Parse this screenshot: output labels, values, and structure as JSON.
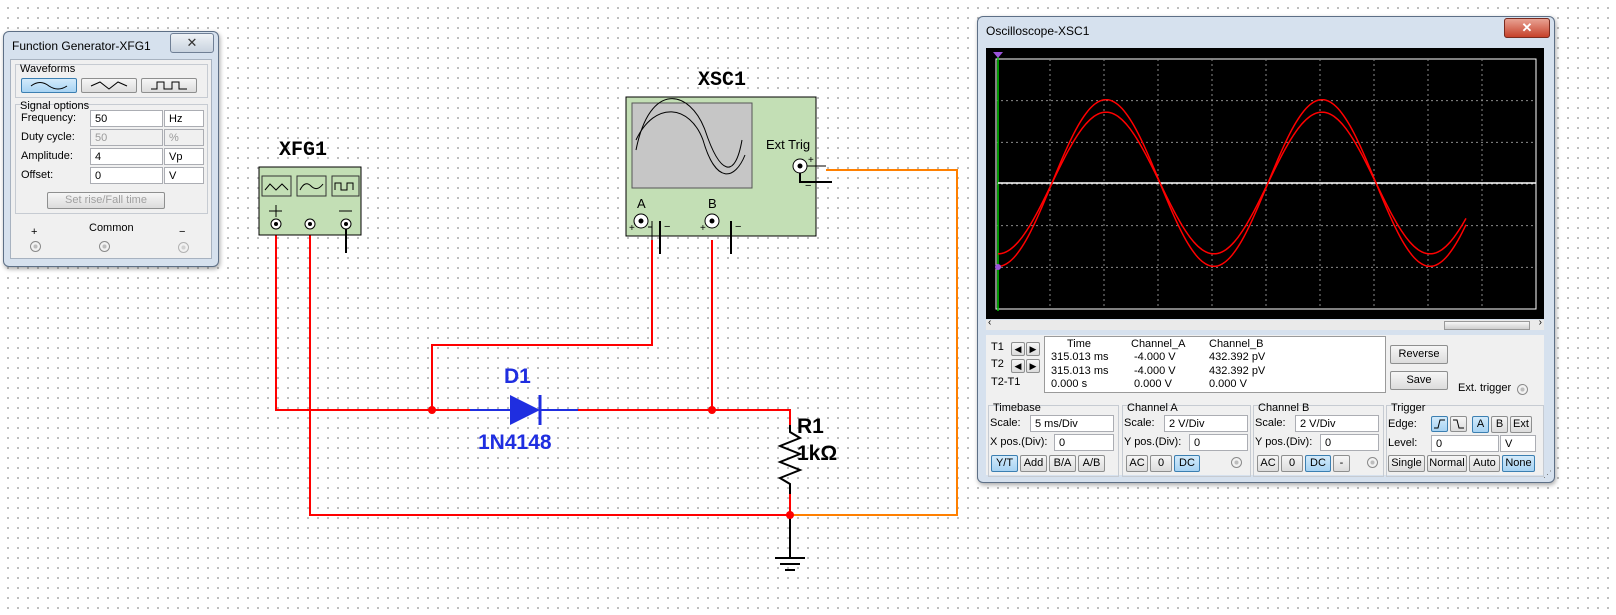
{
  "function_generator": {
    "title": "Function Generator-XFG1",
    "waveforms_label": "Waveforms",
    "waveforms": [
      "sine-wave-icon",
      "triangle-wave-icon",
      "square-wave-icon"
    ],
    "selected_waveform": "sine-wave-icon",
    "signal_options_label": "Signal options",
    "fields": [
      {
        "label": "Frequency:",
        "value": "50",
        "unit": "Hz",
        "disabled": false
      },
      {
        "label": "Duty cycle:",
        "value": "50",
        "unit": "%",
        "disabled": true
      },
      {
        "label": "Amplitude:",
        "value": "4",
        "unit": "Vp",
        "disabled": false
      },
      {
        "label": "Offset:",
        "value": "0",
        "unit": "V",
        "disabled": false
      }
    ],
    "rise_fall_button": "Set rise/Fall time",
    "plus": "+",
    "common": "Common",
    "minus": "−"
  },
  "circuit": {
    "xfg_label": "XFG1",
    "xsc_label": "XSC1",
    "ext_trig": "Ext Trig",
    "channel_a": "A",
    "channel_b": "B",
    "diode_name": "D1",
    "diode_model": "1N4148",
    "resistor_name": "R1",
    "resistor_value": "1kΩ",
    "wire_color": "#ff0000",
    "trigger_wire_color": "#ff8000",
    "diode_color": "#1f2ee0"
  },
  "oscilloscope": {
    "title": "Oscilloscope-XSC1",
    "trace_color": "#ff0000",
    "readout_headers": [
      "",
      "Time",
      "Channel_A",
      "Channel_B"
    ],
    "readout_rows": [
      {
        "name": "T1",
        "time": "315.013 ms",
        "a": "-4.000 V",
        "b": "432.392 pV"
      },
      {
        "name": "T2",
        "time": "315.013 ms",
        "a": "-4.000 V",
        "b": "432.392 pV"
      },
      {
        "name": "T2-T1",
        "time": "0.000 s",
        "a": "0.000 V",
        "b": "0.000 V"
      }
    ],
    "reverse": "Reverse",
    "save": "Save",
    "ext_trigger": "Ext. trigger",
    "timebase": {
      "title": "Timebase",
      "scale_label": "Scale:",
      "scale": "5 ms/Div",
      "pos_label": "X pos.(Div):",
      "pos": "0",
      "buttons": [
        "Y/T",
        "Add",
        "B/A",
        "A/B"
      ],
      "active": "Y/T"
    },
    "channel_a": {
      "title": "Channel A",
      "scale_label": "Scale:",
      "scale": "2  V/Div",
      "pos_label": "Y pos.(Div):",
      "pos": "0",
      "buttons": [
        "AC",
        "0",
        "DC"
      ],
      "active": "DC"
    },
    "channel_b": {
      "title": "Channel B",
      "scale_label": "Scale:",
      "scale": "2  V/Div",
      "pos_label": "Y pos.(Div):",
      "pos": "0",
      "buttons": [
        "AC",
        "0",
        "DC",
        "-"
      ],
      "active": "DC"
    },
    "trigger": {
      "title": "Trigger",
      "edge_label": "Edge:",
      "edge_buttons": [
        "rising-edge-icon",
        "falling-edge-icon"
      ],
      "source_buttons": [
        "A",
        "B",
        "Ext"
      ],
      "source_active": "A",
      "level_label": "Level:",
      "level": "0",
      "level_unit": "V",
      "mode_buttons": [
        "Single",
        "Normal",
        "Auto",
        "None"
      ],
      "mode_active": "None"
    }
  }
}
